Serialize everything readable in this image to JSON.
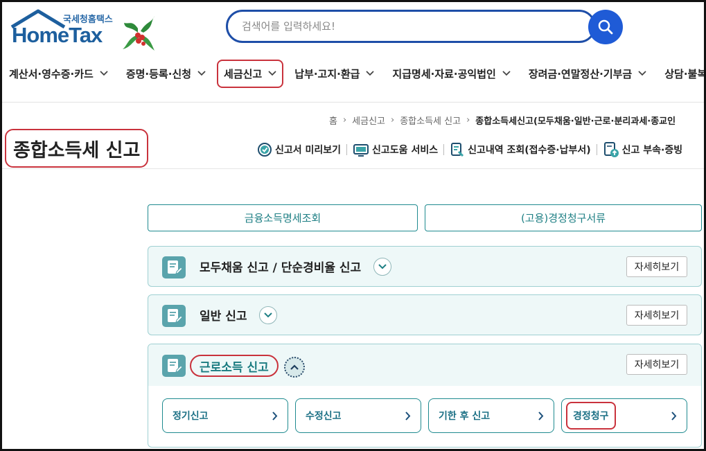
{
  "logo": {
    "sub": "국세청홈택스",
    "main": "HomeTax"
  },
  "search": {
    "placeholder": "검색어를 입력하세요!"
  },
  "gnb": [
    "계산서·영수증·카드",
    "증명·등록·신청",
    "세금신고",
    "납부·고지·환급",
    "지급명세·자료·공익법인",
    "장려금·연말정산·기부금",
    "상담·불복·제"
  ],
  "breadcrumb": {
    "home": "홈",
    "level1": "세금신고",
    "level2": "종합소득세 신고",
    "current": "종합소득세신고(모두채움·일반·근로·분리과세·종교인"
  },
  "page_title": "종합소득세 신고",
  "tools": [
    "신고서 미리보기",
    "신고도움 서비스",
    "신고내역 조회(접수증·납부서)",
    "신고 부속·증빙"
  ],
  "top_buttons": [
    "금융소득명세조회",
    "(고용)경정청구서류"
  ],
  "cards": [
    {
      "title": "모두채움 신고 / 단순경비율 신고",
      "detail": "자세히보기"
    },
    {
      "title": "일반 신고",
      "detail": "자세히보기"
    }
  ],
  "expanded_card": {
    "title": "근로소득 신고",
    "detail": "자세히보기",
    "buttons": [
      "정기신고",
      "수정신고",
      "기한 후 신고",
      "경정청구"
    ]
  },
  "colors": {
    "accent": "#1e8a8f",
    "highlight": "#c9323c",
    "search_border": "#1e4ea8",
    "search_button": "#1f5bd6",
    "card_bg": "#eef8f8"
  }
}
